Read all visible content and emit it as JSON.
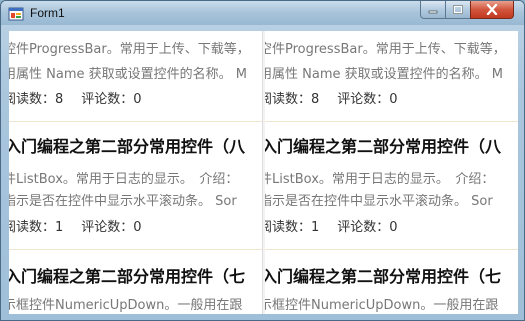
{
  "window": {
    "title": "Form1"
  },
  "controls": {
    "minimize": "minimize",
    "maximize": "maximize",
    "close": "close"
  },
  "columns": [
    {
      "items": [
        {
          "lines": [
            "控件ProgressBar。常用于上传、下载等，",
            "用属性 Name 获取或设置控件的名称。 M"
          ],
          "read": "阅读数：8",
          "comments": "评论数：0"
        },
        {
          "title": "入门编程之第二部分常用控件（八",
          "lines": [
            "件ListBox。常用于日志的显示。　介绍：",
            "指示是否在控件中显示水平滚动条。 Sor"
          ],
          "read": "阅读数：1",
          "comments": "评论数：0"
        },
        {
          "title": "入门编程之第二部分常用控件（七",
          "lines": [
            "示框控件NumericUpDown。一般用在跟"
          ]
        }
      ]
    },
    {
      "items": [
        {
          "lines": [
            "空件ProgressBar。常用于上传、下载等，",
            "用属性 Name 获取或设置控件的名称。 M"
          ],
          "read": "阅读数：8",
          "comments": "评论数：0"
        },
        {
          "title": "入门编程之第二部分常用控件（八",
          "lines": [
            "件ListBox。常用于日志的显示。　介绍：",
            "指示是否在控件中显示水平滚动条。 Sor"
          ],
          "read": "阅读数：1",
          "comments": "评论数：0"
        },
        {
          "title": "入门编程之第二部分常用控件（七",
          "lines": [
            "示框控件NumericUpDown。一般用在跟"
          ]
        }
      ]
    }
  ]
}
